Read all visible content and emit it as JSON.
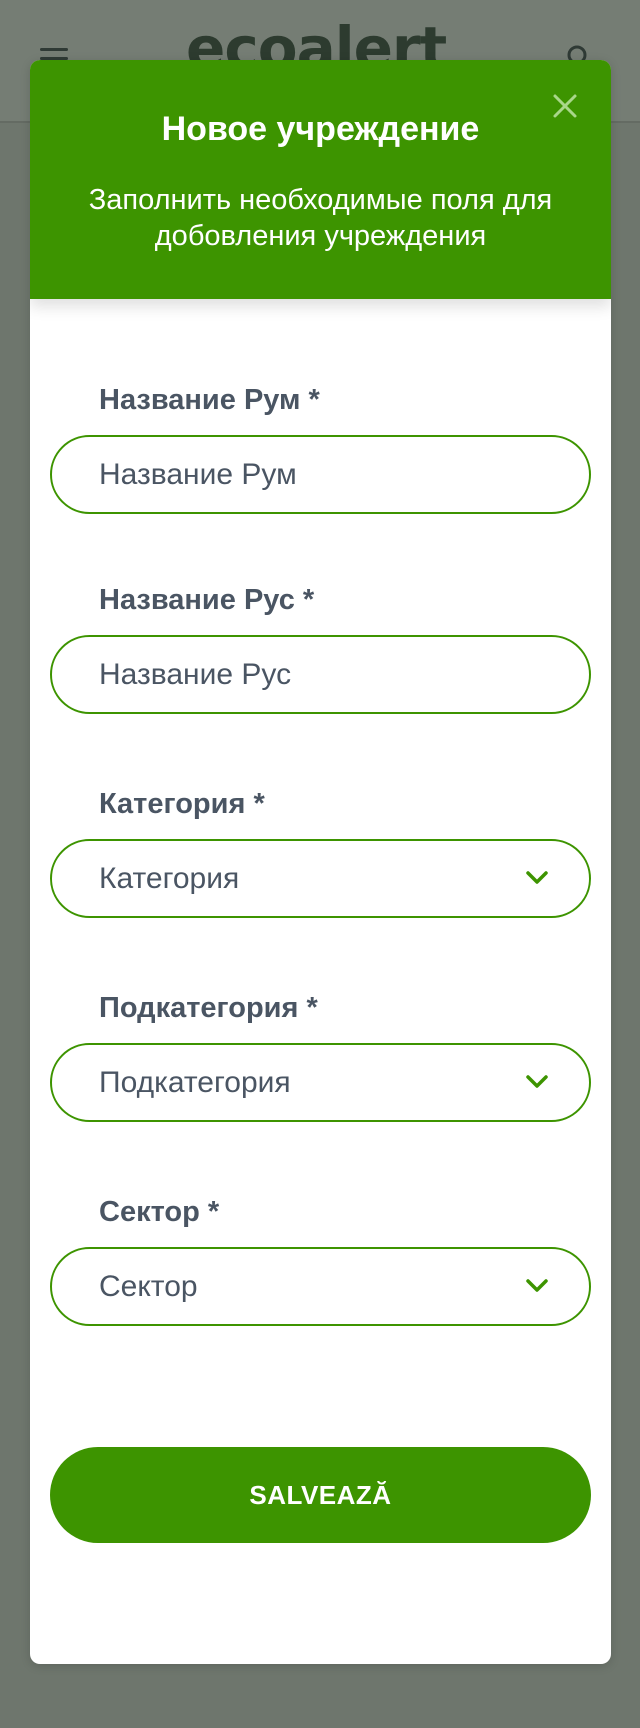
{
  "background": {
    "logo_text": "ecoalert"
  },
  "modal": {
    "title": "Новое учреждение",
    "subtitle": "Заполнить необходимые поля для добовления учреждения",
    "fields": [
      {
        "label": "Название Рум *",
        "placeholder": "Название Рум",
        "type": "text"
      },
      {
        "label": "Название Рус *",
        "placeholder": "Название Рус",
        "type": "text"
      },
      {
        "label": "Категория *",
        "value": "Категория",
        "type": "select"
      },
      {
        "label": "Подкатегория *",
        "value": "Подкатегория",
        "type": "select"
      },
      {
        "label": "Сектор *",
        "value": "Сектор",
        "type": "select"
      }
    ],
    "save_label": "SALVEAZĂ"
  },
  "colors": {
    "brand_green": "#3d9400",
    "text_gray": "#4a5563",
    "overlay": "#6e766d"
  },
  "icons": {
    "close": "close-icon",
    "chevron": "chevron-down-icon",
    "menu": "hamburger-menu-icon",
    "search": "search-icon"
  }
}
